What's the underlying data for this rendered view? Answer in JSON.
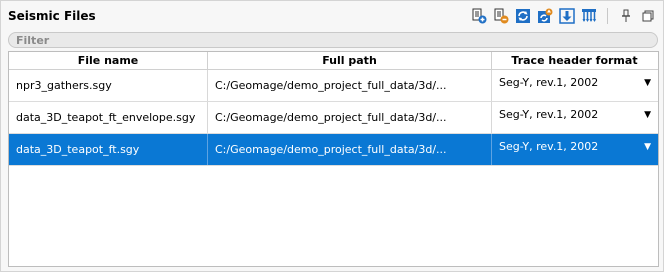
{
  "panel": {
    "title": "Seismic Files"
  },
  "toolbar": {
    "icons": [
      "add-file-icon",
      "remove-file-icon",
      "refresh-icon",
      "reload-upload-icon",
      "download-icon",
      "trace-header-icon",
      "pin-icon",
      "float-window-icon"
    ]
  },
  "filter": {
    "placeholder": "Filter"
  },
  "table": {
    "headers": [
      "File name",
      "Full path",
      "Trace header format"
    ],
    "rows": [
      {
        "file_name": "npr3_gathers.sgy",
        "full_path": "C:/Geomage/demo_project_full_data/3d/...",
        "format": "Seg-Y, rev.1, 2002"
      },
      {
        "file_name": "data_3D_teapot_ft_envelope.sgy",
        "full_path": "C:/Geomage/demo_project_full_data/3d/...",
        "format": "Seg-Y, rev.1, 2002"
      },
      {
        "file_name": "data_3D_teapot_ft.sgy",
        "full_path": "C:/Geomage/demo_project_full_data/3d/...",
        "format": "Seg-Y, rev.1, 2002",
        "selected": true
      }
    ]
  },
  "colors": {
    "selection": "#0a78d4",
    "icon_blue": "#1f6fc5",
    "icon_orange": "#e08a1e"
  }
}
